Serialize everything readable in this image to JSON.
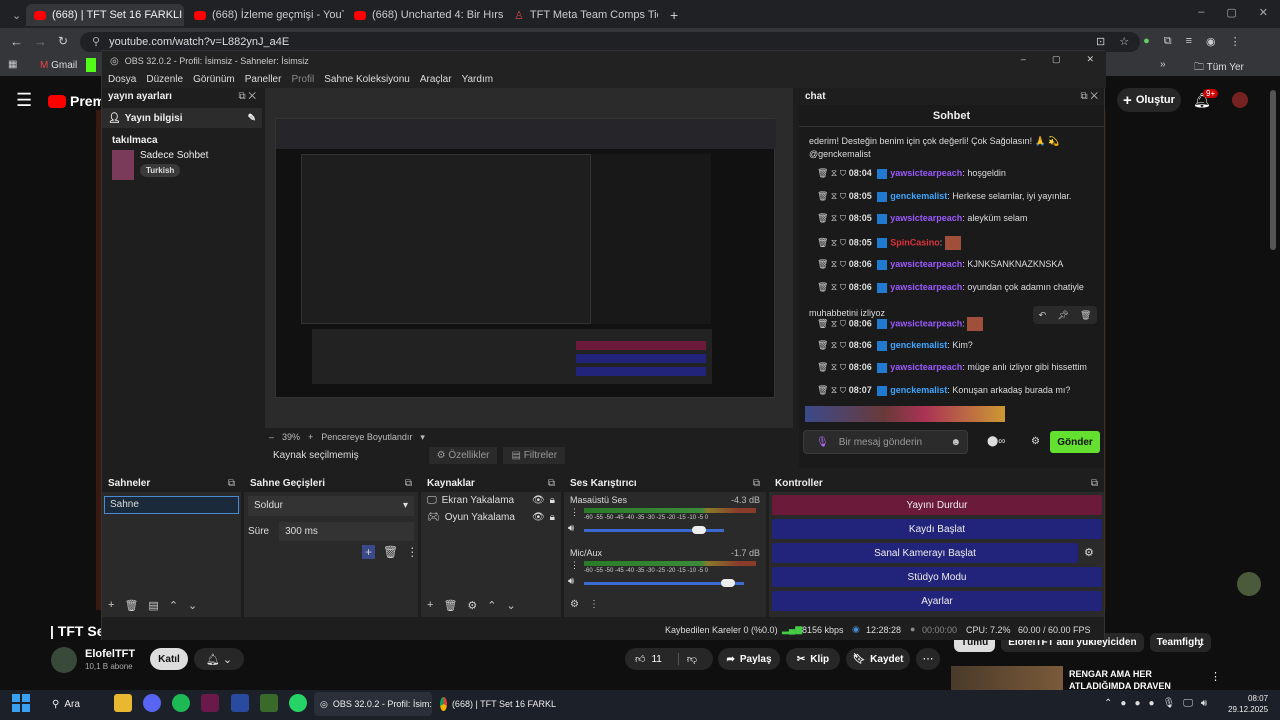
{
  "browser": {
    "tabs": [
      {
        "label": "(668) | TFT Set 16 FARKLI COMP"
      },
      {
        "label": "(668) İzleme geçmişi - YouTube"
      },
      {
        "label": "(668) Uncharted 4: Bir Hırsızın S"
      },
      {
        "label": "TFT Meta Team Comps Tier List"
      }
    ],
    "url": "youtube.com/watch?v=L882ynJ_a4E",
    "bookmarks": [
      {
        "label": "Gmail"
      }
    ],
    "all_bookmarks": "Tüm Yer İşaretleri"
  },
  "youtube": {
    "logo": "Premi",
    "create": "Oluştur",
    "notif_count": "9+",
    "video_title": "| TFT Set",
    "channel": "ElofelTFT",
    "subs": "10,1 B abone",
    "join": "Katıl",
    "likes": "11",
    "share": "Paylaş",
    "clip": "Klip",
    "save": "Kaydet",
    "chips": [
      "Tümü",
      "ElofelTFT adlı yükleyiciden",
      "Teamfight"
    ],
    "rec_title1": "RENGAR AMA HER",
    "rec_title2": "ATLADIĞIMDA DRAVEN"
  },
  "obs": {
    "title": "OBS 32.0.2 - Profil: İsimsiz - Sahneler: İsimsiz",
    "menu": [
      "Dosya",
      "Düzenle",
      "Görünüm",
      "Paneller",
      "Profil",
      "Sahne Koleksiyonu",
      "Araçlar",
      "Yardım"
    ],
    "stream_panel": {
      "title": "yayın ayarları",
      "info": "Yayın bilgisi",
      "category": "takılmaca",
      "game": "Sadece Sohbet",
      "tag": "Turkish"
    },
    "preview": {
      "zoom": "39%",
      "fit": "Pencereye Boyutlandır"
    },
    "source_bar": {
      "status": "Kaynak seçilmemiş",
      "props": "Özellikler",
      "filters": "Filtreler"
    },
    "chat": {
      "dock_title": "chat",
      "header": "Sohbet",
      "intro": "ederim! Desteğin benim için çok değerli! Çok Sağolasın! 🙏 💫",
      "intro_user": "@genckemalist",
      "messages": [
        {
          "time": "08:04",
          "user": "yawsictearpeach",
          "text": "hoşgeldin",
          "color": "#9b59ff"
        },
        {
          "time": "08:05",
          "user": "genckemalist",
          "text": "Herkese selamlar, iyi yayınlar.",
          "color": "#3ea6ff"
        },
        {
          "time": "08:05",
          "user": "yawsictearpeach",
          "text": "aleyküm selam",
          "color": "#9b59ff"
        },
        {
          "time": "08:05",
          "user": "SpinCasino",
          "text": "",
          "color": "#e0303a"
        },
        {
          "time": "08:06",
          "user": "yawsictearpeach",
          "text": "KJNKSANKNAZKNSKA",
          "color": "#9b59ff"
        },
        {
          "time": "08:06",
          "user": "yawsictearpeach",
          "text": "oyundan çok adamın chatiyle",
          "color": "#9b59ff"
        },
        {
          "time": "08:06",
          "user": "yawsictearpeach",
          "text": "",
          "color": "#9b59ff"
        },
        {
          "time": "08:06",
          "user": "genckemalist",
          "text": "Kim?",
          "color": "#3ea6ff"
        },
        {
          "time": "08:06",
          "user": "yawsictearpeach",
          "text": "müge anlı izliyor gibi hissettim",
          "color": "#9b59ff"
        },
        {
          "time": "08:07",
          "user": "genckemalist",
          "text": "Konuşan arkadaş burada mı?",
          "color": "#3ea6ff"
        }
      ],
      "wrap_line": "muhabbetini izliyoz",
      "input_placeholder": "Bir mesaj gönderin",
      "send": "Gönder"
    },
    "scenes": {
      "title": "Sahneler",
      "items": [
        "Sahne"
      ]
    },
    "transitions": {
      "title": "Sahne Geçişleri",
      "type": "Soldur",
      "duration_label": "Süre",
      "duration": "300 ms"
    },
    "sources": {
      "title": "Kaynaklar",
      "items": [
        "Ekran Yakalama",
        "Oyun Yakalama"
      ]
    },
    "mixer": {
      "title": "Ses Karıştırıcı",
      "channels": [
        {
          "name": "Masaüstü Ses",
          "db": "-4.3 dB",
          "level": 0.82
        },
        {
          "name": "Mic/Aux",
          "db": "-1.7 dB",
          "level": 0.9
        }
      ],
      "scale": "-60 -55 -50 -45 -40 -35 -30 -25 -20 -15 -10 -5 0"
    },
    "controls": {
      "title": "Kontroller",
      "buttons": [
        "Yayını Durdur",
        "Kaydı Başlat",
        "Sanal Kamerayı Başlat",
        "Stüdyo Modu",
        "Ayarlar"
      ]
    },
    "status": {
      "dropped": "Kaybedilen Kareler 0 (%0.0)",
      "bitrate": "8156 kbps",
      "stream_time": "12:28:28",
      "rec_time": "00:00:00",
      "cpu": "CPU: 7.2%",
      "fps": "60.00 / 60.00 FPS"
    }
  },
  "taskbar": {
    "search": "Ara",
    "obs_task": "OBS 32.0.2 - Profil: İsim:",
    "chrome_task": "(668) | TFT Set 16 FARKL",
    "time": "08:07",
    "date": "29.12.2025"
  },
  "colors": {
    "stop": "#6b1a3a",
    "blue_btn": "#22237a",
    "send": "#64e031"
  }
}
